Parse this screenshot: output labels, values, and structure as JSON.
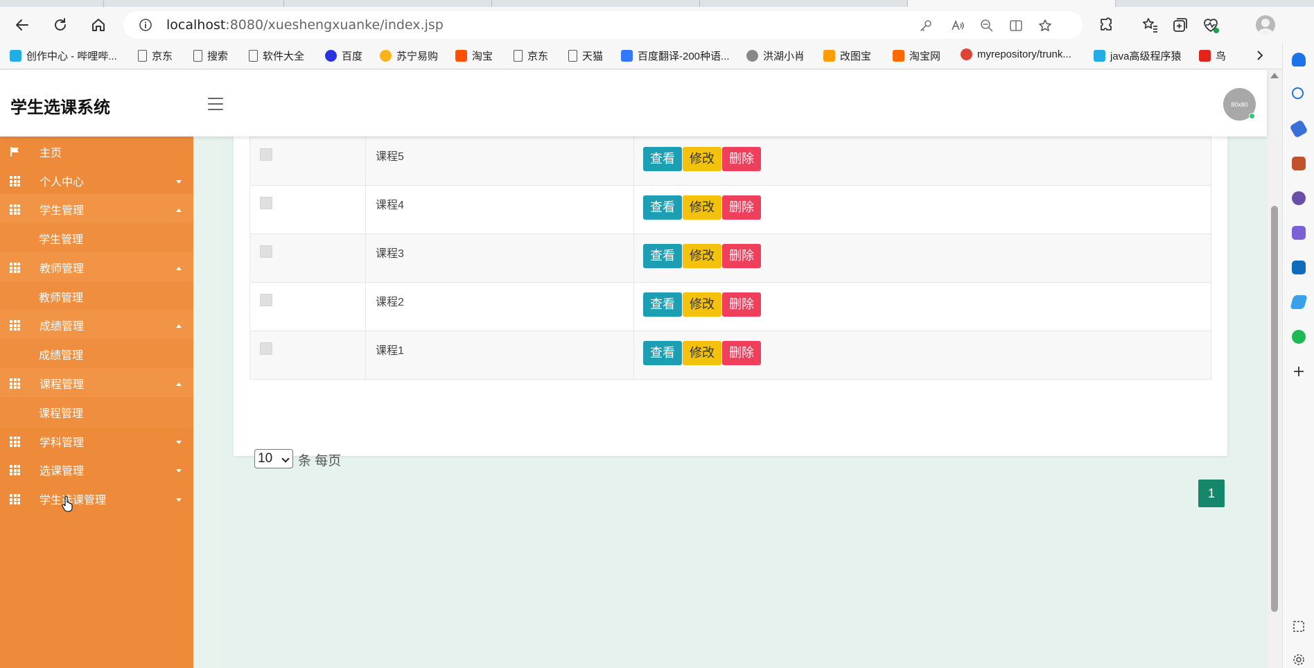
{
  "browser": {
    "url_host": "localhost",
    "url_rest": ":8080/xueshengxuanke/index.jsp",
    "bookmarks": [
      {
        "label": "创作中心 - 哔哩哔...",
        "color": "#23ade5",
        "icon": "bilibili-icon"
      },
      {
        "label": "京东",
        "color": "",
        "icon": "page-icon"
      },
      {
        "label": "搜索",
        "color": "",
        "icon": "page-icon"
      },
      {
        "label": "软件大全",
        "color": "",
        "icon": "page-icon"
      },
      {
        "label": "百度",
        "color": "#2932e1",
        "icon": "baidu-icon"
      },
      {
        "label": "苏宁易购",
        "color": "#f9b31a",
        "icon": "suning-icon"
      },
      {
        "label": "淘宝",
        "color": "#ff5000",
        "icon": "taobao-icon"
      },
      {
        "label": "京东",
        "color": "",
        "icon": "page-icon"
      },
      {
        "label": "天猫",
        "color": "",
        "icon": "page-icon"
      },
      {
        "label": "百度翻译-200种语...",
        "color": "#3377ff",
        "icon": "baidu-translate-icon"
      },
      {
        "label": "洪湖小肖",
        "color": "#888888",
        "icon": "bird-icon"
      },
      {
        "label": "改图宝",
        "color": "#ff9c00",
        "icon": "gaitubao-icon"
      },
      {
        "label": "淘宝网",
        "color": "#ff6a00",
        "icon": "taobao-icon"
      },
      {
        "label": "myrepository/trunk...",
        "color": "#db4437",
        "icon": "chrome-icon"
      },
      {
        "label": "java高级程序猿",
        "color": "#23ade5",
        "icon": "bilibili-icon"
      },
      {
        "label": "鸟",
        "color": "#e1251b",
        "icon": "bird-icon"
      }
    ]
  },
  "app": {
    "title": "学生选课系统",
    "avatar_text": "80x80",
    "menu": [
      {
        "label": "主页",
        "type": "home",
        "caret": ""
      },
      {
        "label": "个人中心",
        "type": "parent",
        "caret": "down"
      },
      {
        "label": "学生管理",
        "type": "parent-open",
        "caret": "up"
      },
      {
        "label": "学生管理",
        "type": "child",
        "caret": ""
      },
      {
        "label": "教师管理",
        "type": "parent-open",
        "caret": "up"
      },
      {
        "label": "教师管理",
        "type": "child",
        "caret": ""
      },
      {
        "label": "成绩管理",
        "type": "parent-open",
        "caret": "up"
      },
      {
        "label": "成绩管理",
        "type": "child",
        "caret": ""
      },
      {
        "label": "课程管理",
        "type": "parent-open",
        "caret": "up"
      },
      {
        "label": "课程管理",
        "type": "child",
        "caret": ""
      },
      {
        "label": "学科管理",
        "type": "parent",
        "caret": "down"
      },
      {
        "label": "选课管理",
        "type": "parent",
        "caret": "down"
      },
      {
        "label": "学生选课管理",
        "type": "parent",
        "caret": "down"
      }
    ],
    "table": {
      "rows": [
        {
          "name": "课程5"
        },
        {
          "name": "课程4"
        },
        {
          "name": "课程3"
        },
        {
          "name": "课程2"
        },
        {
          "name": "课程1"
        }
      ],
      "actions": {
        "view": "查看",
        "edit": "修改",
        "delete": "删除"
      }
    },
    "pager": {
      "page_size": "10",
      "page_size_suffix": "条 每页",
      "current_page": "1"
    }
  }
}
